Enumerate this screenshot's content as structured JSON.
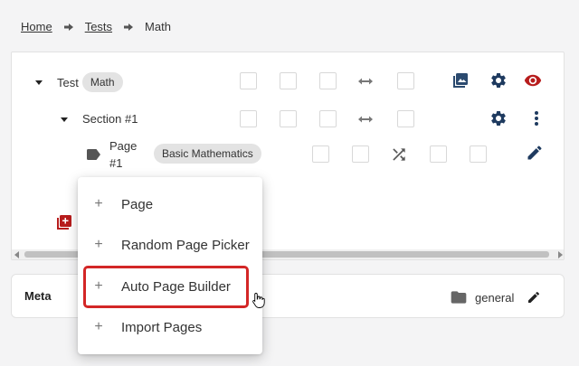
{
  "breadcrumb": {
    "home": "Home",
    "tests": "Tests",
    "current": "Math"
  },
  "tree": {
    "test": {
      "label": "Test",
      "chip": "Math"
    },
    "section": {
      "label": "Section #1"
    },
    "page": {
      "label_line1": "Page",
      "label_line2": "#1",
      "chip": "Basic Mathematics"
    }
  },
  "menu": {
    "items": [
      {
        "label": "Page"
      },
      {
        "label": "Random Page Picker"
      },
      {
        "label": "Auto Page Builder"
      },
      {
        "label": "Import Pages"
      }
    ],
    "highlighted_index": 2
  },
  "meta": {
    "title": "Meta",
    "folder": "general"
  },
  "colors": {
    "accent_blue": "#1e3a5f",
    "accent_red": "#b71c1c",
    "highlight": "#d32626"
  },
  "icons": {
    "breadcrumb_separator": "arrow-right-icon",
    "test_images": "image-gallery-icon",
    "settings": "gear-icon",
    "visibility": "eye-icon",
    "more": "more-vert-icon",
    "tag": "label-tag-icon",
    "shuffle": "shuffle-icon",
    "edit": "pencil-icon",
    "swap": "swap-horizontal-icon",
    "add_section": "add-box-icon",
    "folder": "folder-icon"
  }
}
